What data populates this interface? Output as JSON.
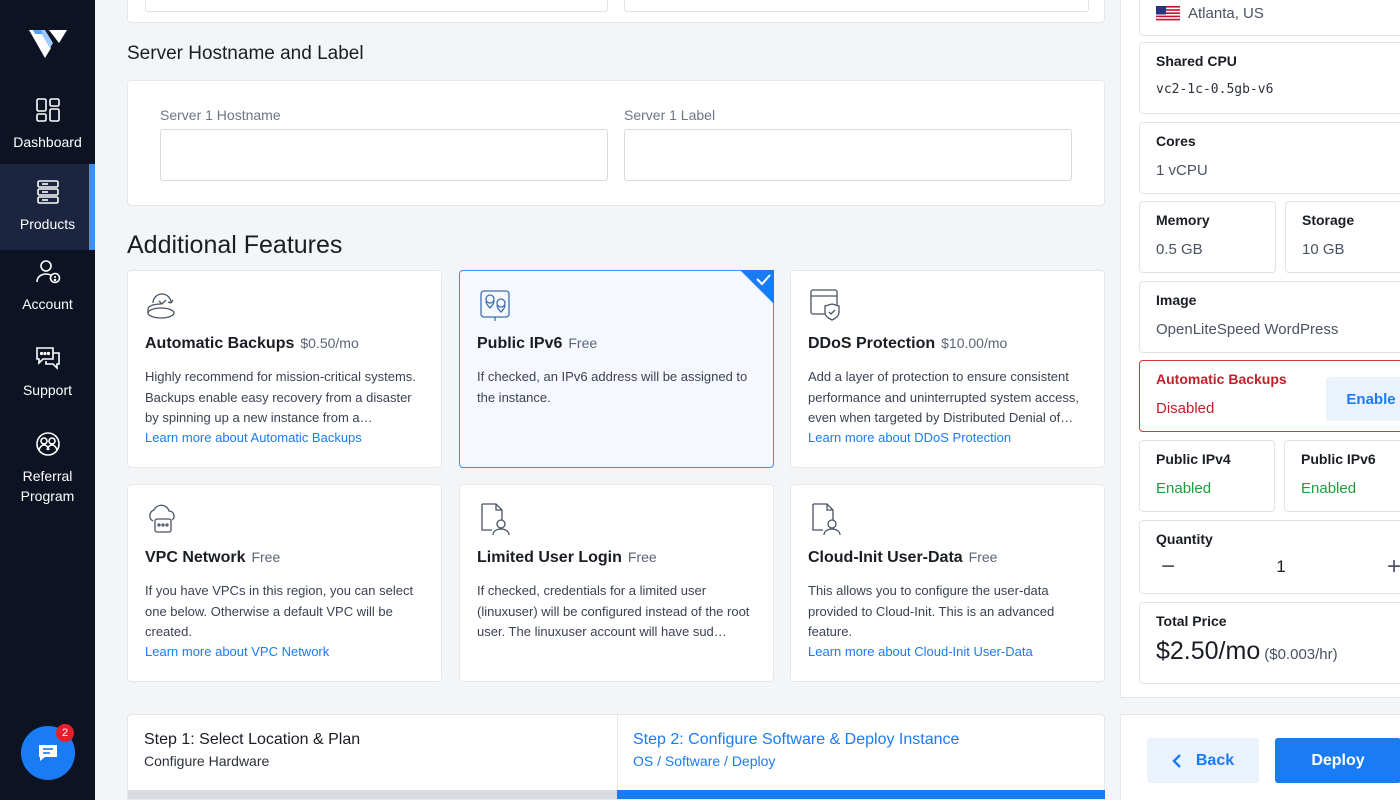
{
  "sidebar": {
    "items": [
      {
        "label": "Dashboard",
        "icon": "dashboard-icon"
      },
      {
        "label": "Products",
        "icon": "server-stack-icon"
      },
      {
        "label": "Account",
        "icon": "account-icon"
      },
      {
        "label": "Support",
        "icon": "support-chat-icon"
      },
      {
        "label": "Referral\nProgram",
        "icon": "referral-icon"
      }
    ],
    "chat_badge": "2"
  },
  "hostname_section": {
    "title": "Server Hostname and Label",
    "hostname_label": "Server 1 Hostname",
    "label_label": "Server 1 Label",
    "hostname_value": "",
    "label_value": ""
  },
  "features": {
    "title": "Additional Features",
    "cards": [
      {
        "title": "Automatic Backups",
        "price": "$0.50/mo",
        "desc": "Highly recommend for mission-critical systems. Backups enable easy recovery from a disaster by spinning up a new instance from a…",
        "link": "Learn more about Automatic Backups",
        "icon": "backup-icon",
        "selected": false
      },
      {
        "title": "Public IPv6",
        "price": "Free",
        "desc": "If checked, an IPv6 address will be assigned to the instance.",
        "link": "",
        "icon": "ipv6-pin-icon",
        "selected": true
      },
      {
        "title": "DDoS Protection",
        "price": "$10.00/mo",
        "desc": "Add a layer of protection to ensure consistent performance and uninterrupted system access, even when targeted by Distributed Denial of…",
        "link": "Learn more about DDoS Protection",
        "icon": "shield-window-icon",
        "selected": false
      },
      {
        "title": "VPC Network",
        "price": "Free",
        "desc": "If you have VPCs in this region, you can select one below. Otherwise a default VPC will be created.",
        "link": "Learn more about VPC Network",
        "icon": "cloud-network-icon",
        "selected": false
      },
      {
        "title": "Limited User Login",
        "price": "Free",
        "desc": "If checked, credentials for a limited user (linuxuser) will be configured instead of the root user. The linuxuser account will have sud…",
        "link": "",
        "icon": "user-document-icon",
        "selected": false
      },
      {
        "title": "Cloud-Init User-Data",
        "price": "Free",
        "desc": "This allows you to configure the user-data provided to Cloud-Init. This is an advanced feature.",
        "link": "Learn more about Cloud-Init User-Data",
        "icon": "cloud-user-document-icon",
        "selected": false
      }
    ]
  },
  "steps": {
    "step1_title": "Step 1: Select Location & Plan",
    "step1_sub": "Configure Hardware",
    "step2_title": "Step 2: Configure Software & Deploy Instance",
    "step2_sub": "OS / Software / Deploy"
  },
  "summary": {
    "location": "Atlanta, US",
    "plan_label": "Shared CPU",
    "plan_value": "vc2-1c-0.5gb-v6",
    "cores_label": "Cores",
    "cores_value": "1 vCPU",
    "memory_label": "Memory",
    "memory_value": "0.5 GB",
    "storage_label": "Storage",
    "storage_value": "10 GB",
    "image_label": "Image",
    "image_value": "OpenLiteSpeed WordPress",
    "backups_label": "Automatic Backups",
    "backups_value": "Disabled",
    "enable_label": "Enable",
    "ipv4_label": "Public IPv4",
    "ipv4_value": "Enabled",
    "ipv6_label": "Public IPv6",
    "ipv6_value": "Enabled",
    "quantity_label": "Quantity",
    "quantity_value": "1",
    "minus": "−",
    "plus": "+",
    "total_label": "Total Price",
    "total_monthly": "$2.50/mo",
    "total_hourly": "($0.003/hr)"
  },
  "actions": {
    "back": "Back",
    "deploy": "Deploy"
  },
  "colors": {
    "accent": "#1a7cf5",
    "sidebar_bg": "#0d1323",
    "enabled_green": "#1f9d3c",
    "disabled_red": "#c0212b"
  }
}
